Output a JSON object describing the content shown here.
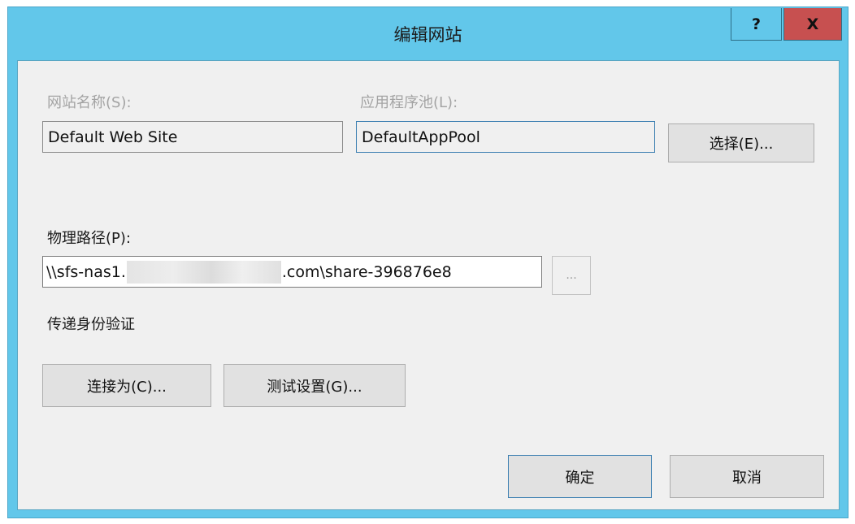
{
  "window": {
    "title": "编辑网站",
    "help_label": "?",
    "close_label": "X"
  },
  "site_name": {
    "label": "网站名称(S):",
    "value": "Default Web Site"
  },
  "app_pool": {
    "label": "应用程序池(L):",
    "value": "DefaultAppPool",
    "select_label": "选择(E)..."
  },
  "physical_path": {
    "label": "物理路径(P):",
    "value_prefix": "\\\\sfs-nas1.",
    "value_suffix": ".com\\share-396876e8",
    "browse_label": "..."
  },
  "pass_through_auth": {
    "label": "传递身份验证",
    "connect_as_label": "连接为(C)...",
    "test_settings_label": "测试设置(G)..."
  },
  "footer": {
    "ok_label": "确定",
    "cancel_label": "取消"
  }
}
